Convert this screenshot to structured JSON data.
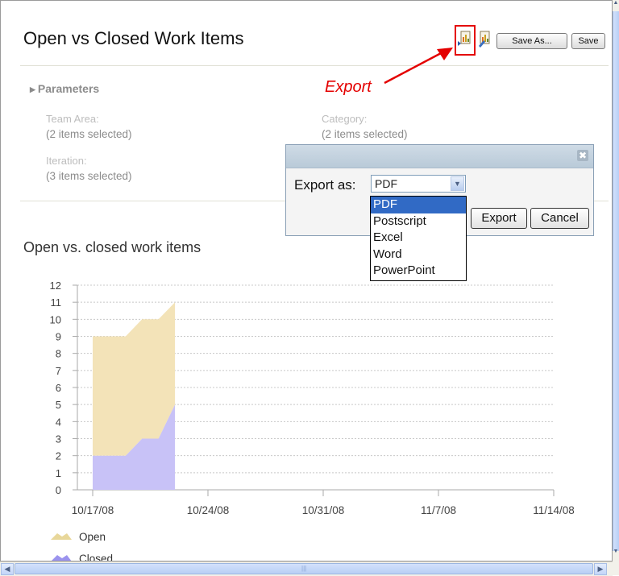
{
  "page": {
    "title": "Open vs Closed Work Items"
  },
  "toolbar": {
    "export_icon": "export-report-icon",
    "edit_icon": "edit-report-icon",
    "save_as_label": "Save As...",
    "save_label": "Save"
  },
  "annotation": {
    "export_callout": "Export",
    "color": "#e40000"
  },
  "parameters": {
    "heading": "Parameters",
    "fields": [
      {
        "label": "Team Area:",
        "value": "(2 items selected)"
      },
      {
        "label": "Category:",
        "value": "(2 items selected)"
      },
      {
        "label": "Iteration:",
        "value": "(3 items selected)"
      }
    ]
  },
  "dialog": {
    "label": "Export as:",
    "selected": "PDF",
    "options": [
      "PDF",
      "Postscript",
      "Excel",
      "Word",
      "PowerPoint"
    ],
    "export_label": "Export",
    "cancel_label": "Cancel",
    "close_icon": "close-icon"
  },
  "chart_data": {
    "type": "area",
    "title": "Open vs. closed work items",
    "x_ticks": [
      "10/17/08",
      "10/24/08",
      "10/31/08",
      "11/7/08",
      "11/14/08"
    ],
    "x_dates": [
      "10/17/08",
      "10/18/08",
      "10/19/08",
      "10/20/08",
      "10/21/08",
      "10/22/08"
    ],
    "ylim": [
      0,
      12
    ],
    "yticks": [
      0,
      1,
      2,
      3,
      4,
      5,
      6,
      7,
      8,
      9,
      10,
      11,
      12
    ],
    "grid": true,
    "legend_position": "bottom-left",
    "stacked": true,
    "series": [
      {
        "name": "Open",
        "values": [
          7,
          7,
          7,
          7,
          7,
          6
        ],
        "color": "#f3e3b8"
      },
      {
        "name": "Closed",
        "values": [
          2,
          2,
          2,
          3,
          3,
          5
        ],
        "color": "#c8c2f7"
      }
    ]
  }
}
